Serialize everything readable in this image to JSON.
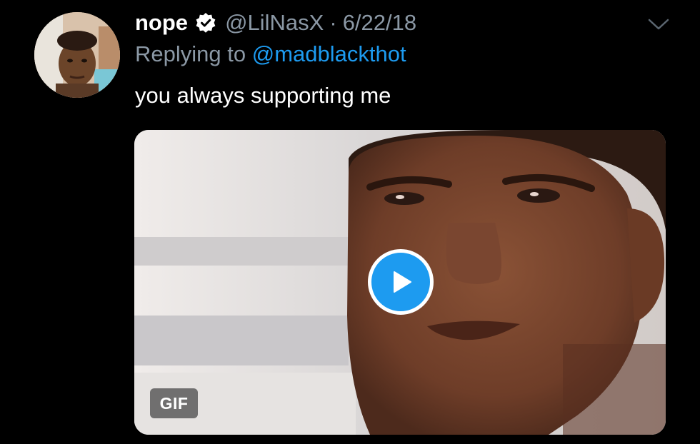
{
  "tweet": {
    "display_name": "nope",
    "handle": "@LilNasX",
    "separator": "·",
    "date": "6/22/18",
    "replying_prefix": "Replying to ",
    "replying_to": "@madblackthot",
    "text": "you always supporting me",
    "verified": true
  },
  "media": {
    "type": "gif",
    "badge_label": "GIF",
    "play_icon": "play-icon"
  },
  "icons": {
    "verified": "verified-badge-icon",
    "menu": "chevron-down-icon"
  },
  "colors": {
    "background": "#000000",
    "primary_text": "#ffffff",
    "secondary_text": "#8b98a5",
    "accent": "#1d9bf0"
  }
}
